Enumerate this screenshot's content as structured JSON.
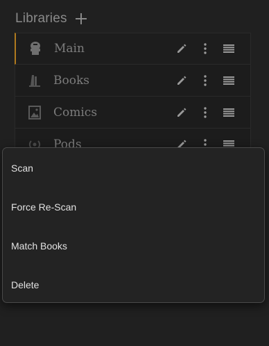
{
  "header": {
    "title": "Libraries"
  },
  "libraries": [
    {
      "label": "Main",
      "icon": "database-icon",
      "active": true
    },
    {
      "label": "Books",
      "icon": "books-icon",
      "active": false
    },
    {
      "label": "Comics",
      "icon": "image-icon",
      "active": false
    },
    {
      "label": "Pods",
      "icon": "podcast-icon",
      "active": false
    }
  ],
  "context_menu": {
    "items": [
      "Scan",
      "Force Re-Scan",
      "Match Books",
      "Delete"
    ]
  },
  "colors": {
    "background": "#202020",
    "row_background": "#1c1c1c",
    "active_accent": "#b07a1e",
    "menu_background": "#232323",
    "menu_border": "#4a4a4a",
    "muted_text": "#7c7c7c",
    "menu_text": "#e2e2e2"
  }
}
